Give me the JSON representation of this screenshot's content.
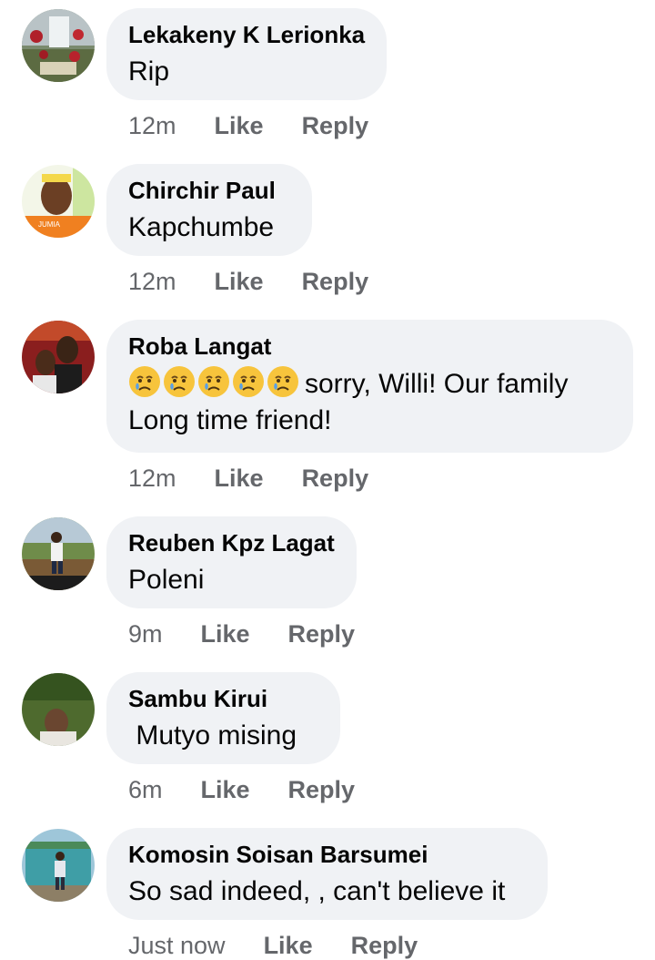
{
  "colors": {
    "bubble": "#f0f2f5",
    "meta": "#65676b",
    "text": "#050505"
  },
  "comments": [
    {
      "author": "Lekakeny K Lerionka",
      "text": "Rip",
      "time": "12m",
      "like": "Like",
      "reply": "Reply",
      "avatar_icon": "roses-avatar"
    },
    {
      "author": "Chirchir Paul",
      "text": "Kapchumbe",
      "time": "12m",
      "like": "Like",
      "reply": "Reply",
      "avatar_icon": "person-orange-avatar"
    },
    {
      "author": "Roba Langat",
      "emojis": [
        "crying-face-icon",
        "crying-face-icon",
        "crying-face-icon",
        "crying-face-icon",
        "crying-face-icon"
      ],
      "text": "sorry, Willi!  Our family",
      "text2": "Long time friend!",
      "time": "12m",
      "like": "Like",
      "reply": "Reply",
      "avatar_icon": "couple-avatar"
    },
    {
      "author": "Reuben Kpz Lagat",
      "text": "Poleni",
      "time": "9m",
      "like": "Like",
      "reply": "Reply",
      "avatar_icon": "man-field-avatar"
    },
    {
      "author": "Sambu Kirui",
      "text": " Mutyo mising",
      "time": "6m",
      "like": "Like",
      "reply": "Reply",
      "avatar_icon": "child-avatar"
    },
    {
      "author": "Komosin Soisan Barsumei",
      "text": "So sad indeed, , can't believe it",
      "time": "Just now",
      "like": "Like",
      "reply": "Reply",
      "avatar_icon": "man-building-avatar"
    }
  ]
}
